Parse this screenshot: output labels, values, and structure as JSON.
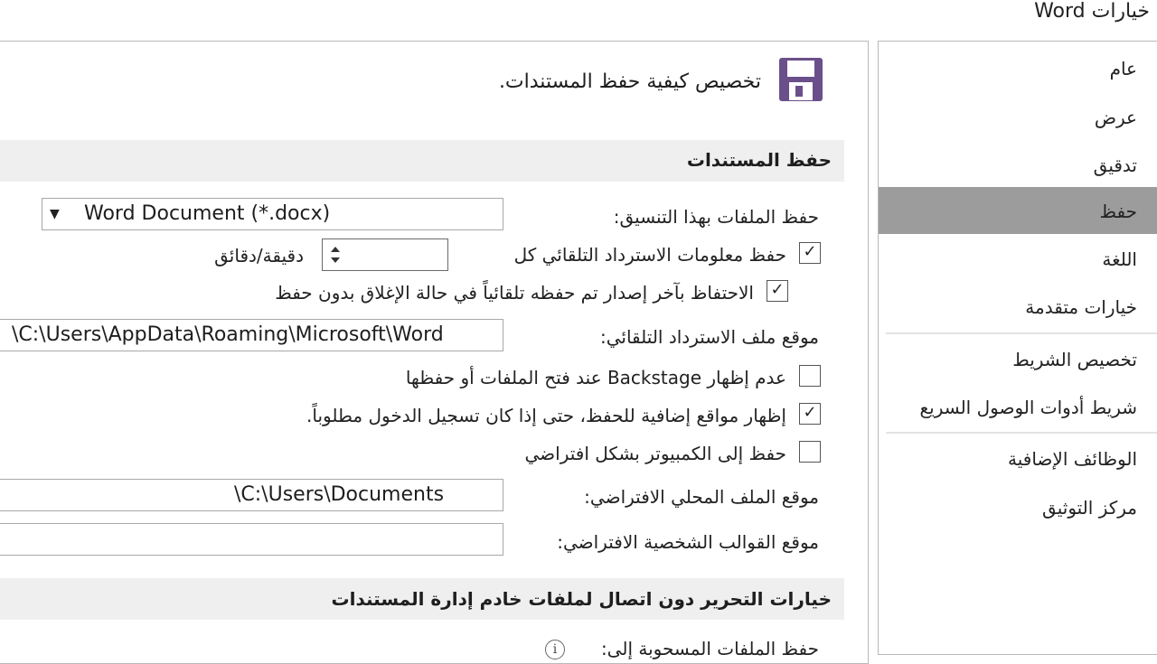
{
  "window": {
    "title": "خيارات Word"
  },
  "sidebar": {
    "items": [
      {
        "label": "عام"
      },
      {
        "label": "عرض"
      },
      {
        "label": "تدقيق"
      },
      {
        "label": "حفظ",
        "selected": true
      },
      {
        "label": "اللغة"
      },
      {
        "label": "خيارات متقدمة"
      },
      {
        "label": "تخصيص الشريط"
      },
      {
        "label": "شريط أدوات الوصول السريع"
      },
      {
        "label": "الوظائف الإضافية"
      },
      {
        "label": "مركز التوثيق"
      }
    ],
    "selected_color": "#9c9c9c"
  },
  "header": {
    "description": "تخصيص كيفية حفظ المستندات.",
    "icon": "save-icon",
    "icon_color": "#6b4f8a"
  },
  "save_section": {
    "title": "حفظ المستندات",
    "format_label": "حفظ الملفات بهذا التنسيق:",
    "format_value": "Word Document (*.docx)",
    "autorecover_label": "حفظ معلومات الاسترداد التلقائي كل",
    "autorecover_checked": true,
    "autorecover_minutes": "",
    "minutes_unit": "دقيقة/دقائق",
    "keep_last_label": "الاحتفاظ بآخر إصدار تم حفظه تلقائياً في حالة الإغلاق بدون حفظ",
    "keep_last_checked": true,
    "autorecover_location_label": "موقع ملف الاسترداد التلقائي:",
    "autorecover_location_value": "C:\\Users\\AppData\\Roaming\\Microsoft\\Word\\",
    "no_backstage_label": "عدم إظهار Backstage عند فتح الملفات أو حفظها",
    "no_backstage_checked": false,
    "show_extra_label": "إظهار مواقع إضافية للحفظ، حتى إذا كان تسجيل الدخول مطلوباً.",
    "show_extra_checked": true,
    "save_to_computer_label": "حفظ إلى الكمبيوتر بشكل افتراضي",
    "save_to_computer_checked": false,
    "default_local_label": "موقع الملف المحلي الافتراضي:",
    "default_local_value": "C:\\Users\\Documents\\",
    "personal_templates_label": "موقع القوالب الشخصية الافتراضي:",
    "personal_templates_value": ""
  },
  "offline_section": {
    "title": "خيارات التحرير دون اتصال لملفات خادم إدارة المستندات",
    "partial_label": "حفظ الملفات المسحوبة إلى:"
  }
}
